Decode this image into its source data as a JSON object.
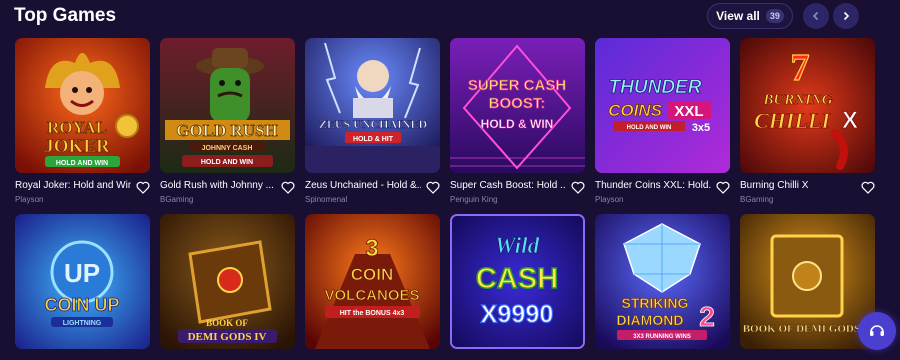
{
  "header": {
    "title": "Top Games",
    "view_all_label": "View all",
    "view_all_count": "39"
  },
  "games_row1": [
    {
      "name": "Royal Joker: Hold and Win",
      "provider": "Playson",
      "art_title": "ROYAL JOKER",
      "art_sub": "HOLD AND WIN"
    },
    {
      "name": "Gold Rush with Johnny ...",
      "provider": "BGaming",
      "art_title": "GOLD RUSH",
      "art_sub": "JOHNNY CASH"
    },
    {
      "name": "Zeus Unchained - Hold &...",
      "provider": "Spinomenal",
      "art_title": "ZEUS UNCHAINED",
      "art_sub": "HOLD & HIT"
    },
    {
      "name": "Super Cash Boost: Hold ...",
      "provider": "Penguin King",
      "art_title": "SUPER CASH BOOST:",
      "art_sub": "HOLD & WIN"
    },
    {
      "name": "Thunder Coins XXL: Hold...",
      "provider": "Playson",
      "art_title": "THUNDER COINS XXL",
      "art_sub": "HOLD AND WIN 3X5"
    },
    {
      "name": "Burning Chilli X",
      "provider": "BGaming",
      "art_title": "BURNING CHILLI X",
      "art_sub": "7"
    }
  ],
  "games_row2": [
    {
      "art_title": "COIN UP",
      "art_sub": "LIGHTNING"
    },
    {
      "art_title": "BOOK OF DEMI GODS IV",
      "art_sub": ""
    },
    {
      "art_title": "3 COIN VOLCANOES",
      "art_sub": "HIT the BONUS 4x3"
    },
    {
      "art_title": "Wild CASH X9990",
      "art_sub": ""
    },
    {
      "art_title": "STRIKING DIAMOND 2",
      "art_sub": "3X3 RUNNING WINS"
    },
    {
      "art_title": "BOOK OF DEMI GODS II",
      "art_sub": ""
    }
  ],
  "colors": {
    "background": "#180f33",
    "accent": "#4b3fd0",
    "provider_text": "#8b85ad"
  },
  "icons": {
    "prev": "chevron-left-icon",
    "next": "chevron-right-icon",
    "favorite": "heart-outline-icon",
    "support": "headset-icon"
  }
}
